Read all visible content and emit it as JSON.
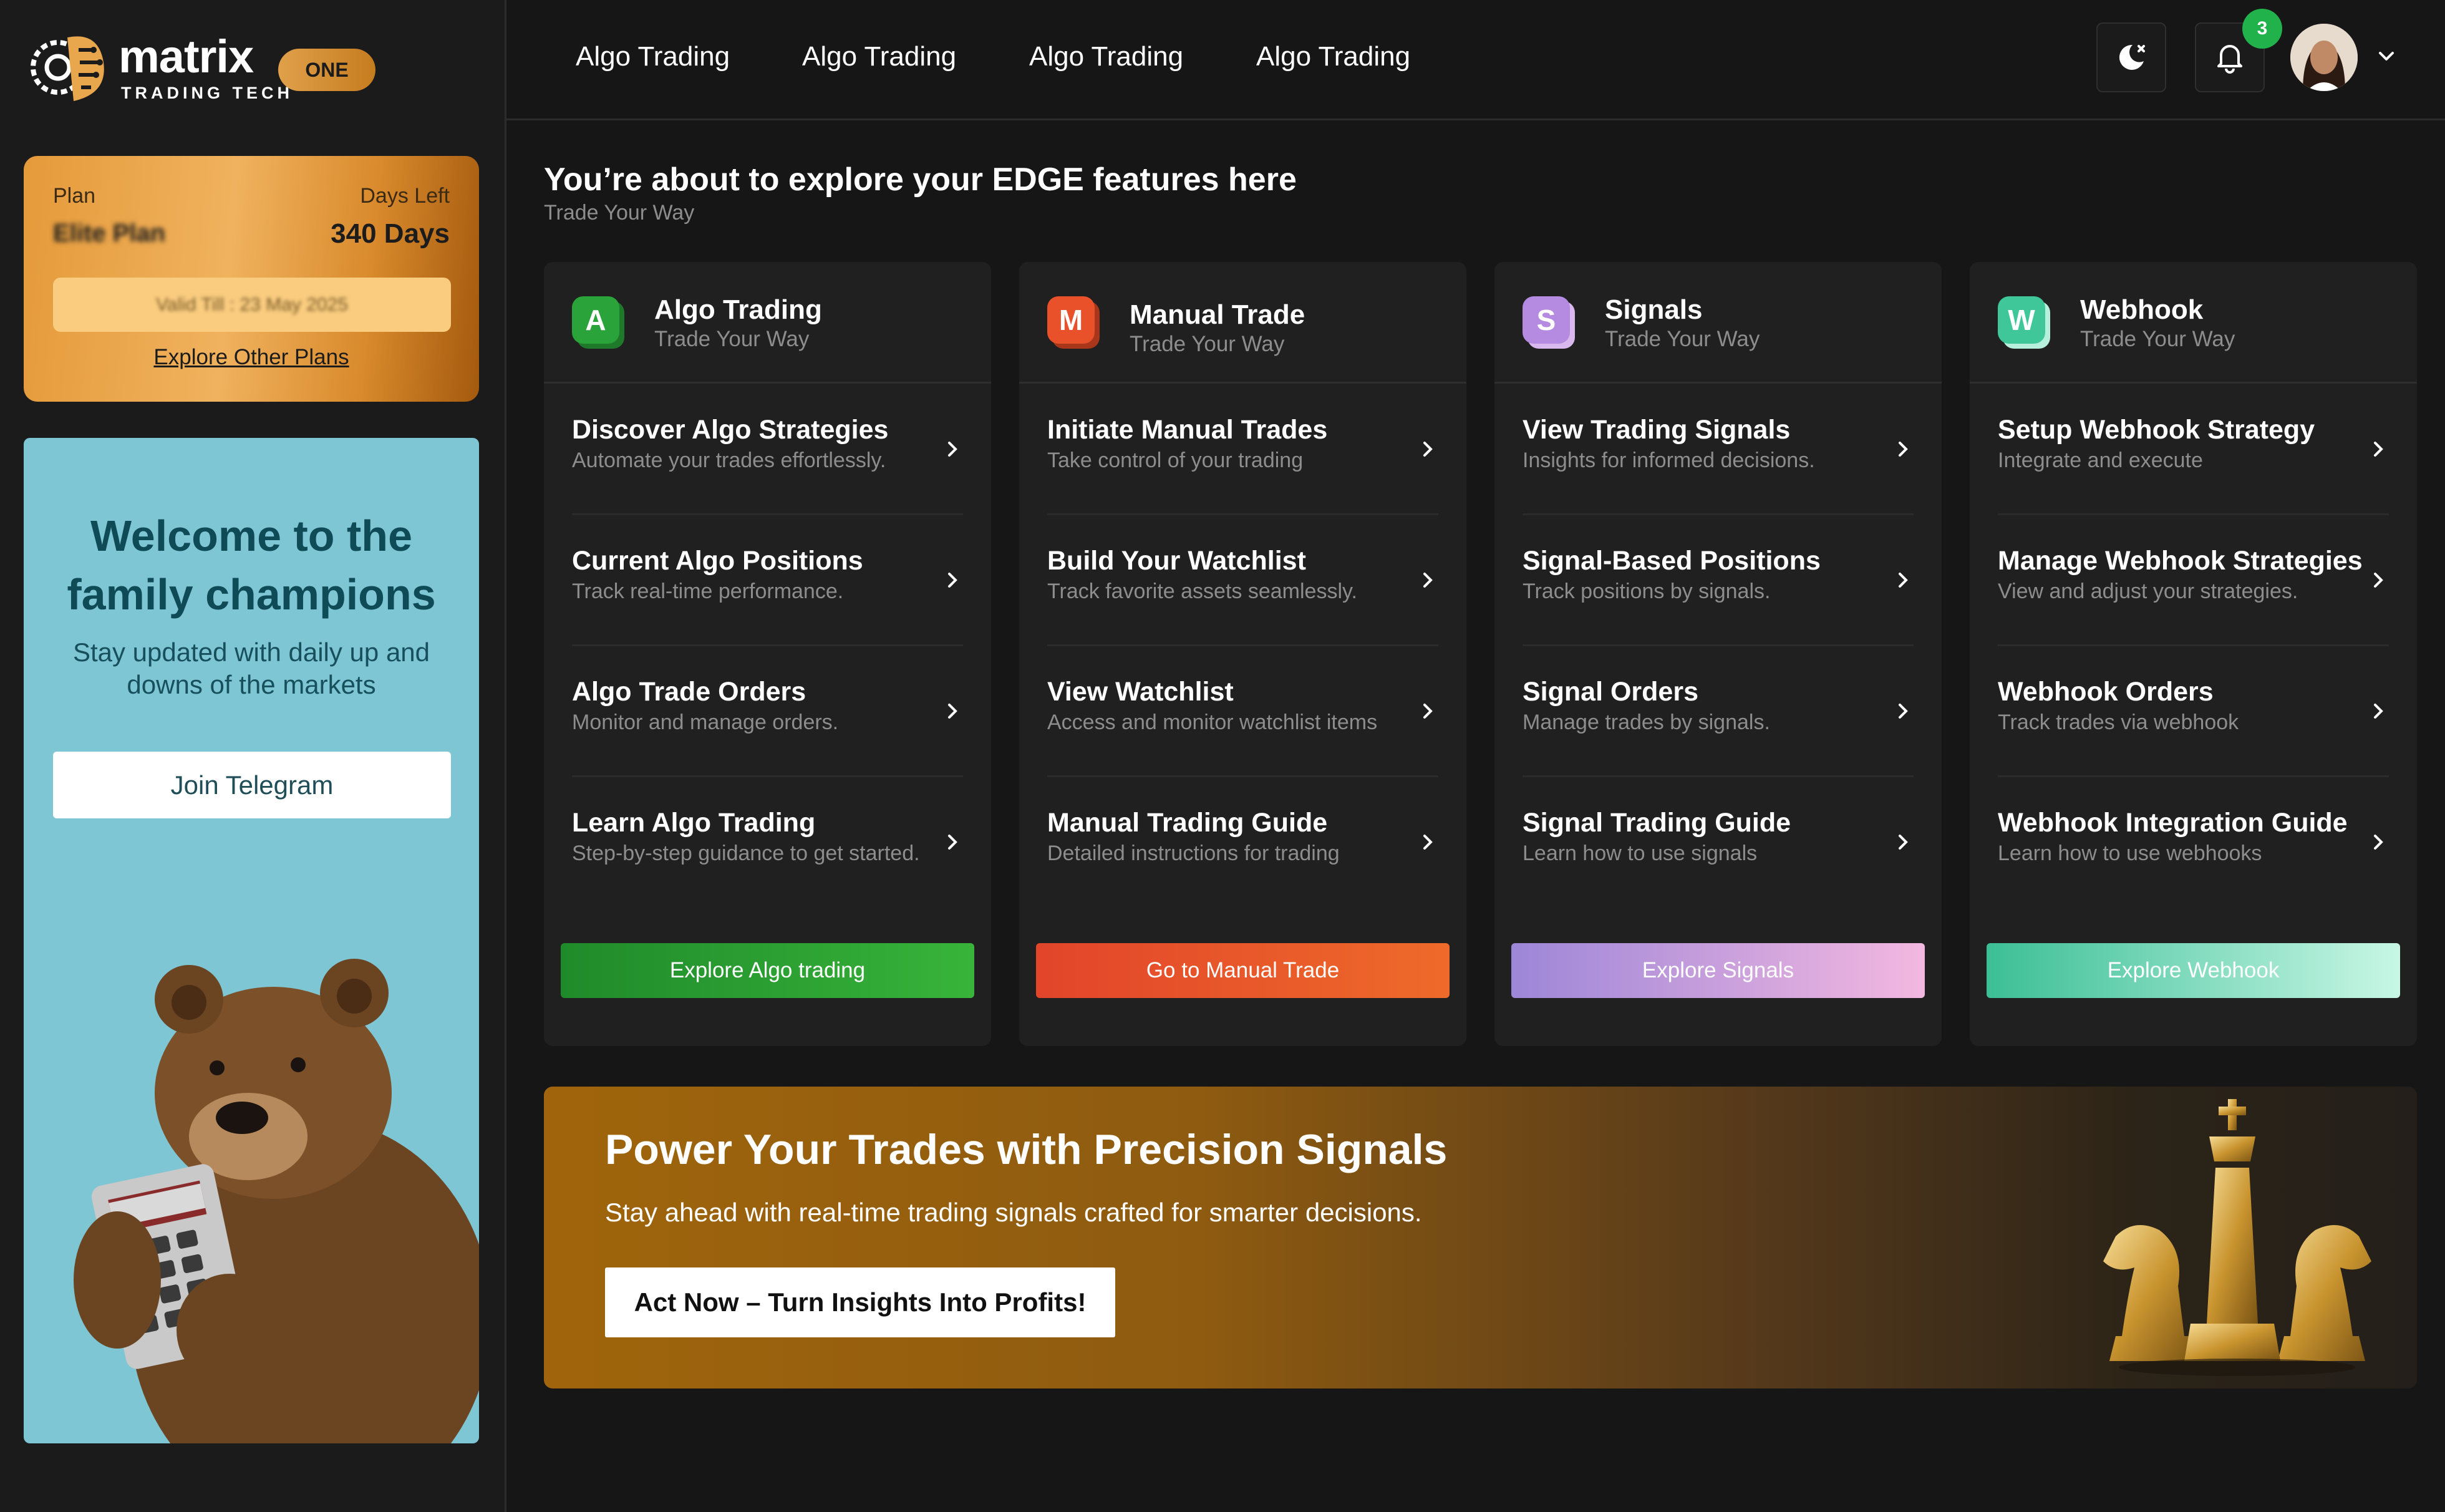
{
  "brand": {
    "name": "matrix",
    "subtitle": "TRADING TECH",
    "badge": "ONE"
  },
  "plan": {
    "plan_label": "Plan",
    "plan_value": "Elite Plan",
    "days_label": "Days Left",
    "days_value": "340 Days",
    "valid_till": "Valid Till : 23 May 2025",
    "explore_link": "Explore Other Plans"
  },
  "promo": {
    "title_line1": "Welcome to the",
    "title_line2": "family champions",
    "subtitle": "Stay updated with daily up and downs of the markets",
    "button": "Join Telegram"
  },
  "nav": {
    "items": [
      "Algo Trading",
      "Algo Trading",
      "Algo Trading",
      "Algo Trading"
    ]
  },
  "header": {
    "notification_count": "3"
  },
  "page": {
    "title": "You’re about to explore your EDGE features here",
    "subtitle": "Trade Your Way"
  },
  "cards": [
    {
      "letter": "A",
      "title": "Algo Trading",
      "tagline": "Trade Your Way",
      "color": "#2aa43a",
      "rows": [
        {
          "title": "Discover Algo Strategies",
          "subtitle": "Automate your trades effortlessly."
        },
        {
          "title": "Current Algo Positions",
          "subtitle": "Track real-time performance."
        },
        {
          "title": "Algo Trade Orders",
          "subtitle": "Monitor and manage orders."
        },
        {
          "title": "Learn Algo Trading",
          "subtitle": "Step-by-step guidance to get started."
        }
      ],
      "button": "Explore Algo trading"
    },
    {
      "letter": "M",
      "title": "Manual Trade",
      "tagline": "Trade Your Way",
      "color": "#e8512a",
      "rows": [
        {
          "title": "Initiate Manual Trades",
          "subtitle": "Take control of your trading"
        },
        {
          "title": "Build Your Watchlist",
          "subtitle": "Track favorite assets seamlessly."
        },
        {
          "title": "View Watchlist",
          "subtitle": "Access and monitor watchlist items"
        },
        {
          "title": "Manual Trading Guide",
          "subtitle": "Detailed instructions for trading"
        }
      ],
      "button": "Go to Manual Trade"
    },
    {
      "letter": "S",
      "title": "Signals",
      "tagline": "Trade Your Way",
      "color": "#b48be0",
      "rows": [
        {
          "title": "View Trading Signals",
          "subtitle": "Insights for informed decisions."
        },
        {
          "title": "Signal-Based Positions",
          "subtitle": "Track positions by signals."
        },
        {
          "title": "Signal Orders",
          "subtitle": "Manage trades by signals."
        },
        {
          "title": "Signal Trading Guide",
          "subtitle": "Learn how to use signals"
        }
      ],
      "button": "Explore Signals"
    },
    {
      "letter": "W",
      "title": "Webhook",
      "tagline": "Trade Your Way",
      "color": "#3fc79a",
      "rows": [
        {
          "title": "Setup Webhook Strategy",
          "subtitle": "Integrate and execute"
        },
        {
          "title": "Manage Webhook Strategies",
          "subtitle": "View and adjust your strategies."
        },
        {
          "title": "Webhook Orders",
          "subtitle": "Track trades via webhook"
        },
        {
          "title": "Webhook Integration Guide",
          "subtitle": "Learn how to use webhooks"
        }
      ],
      "button": "Explore Webhook"
    }
  ],
  "banner": {
    "title": "Power Your Trades with Precision Signals",
    "subtitle": "Stay ahead with real-time trading signals crafted for smarter decisions.",
    "button": "Act Now – Turn Insights Into Profits!"
  },
  "icons": {
    "logo": "gear-brain-logo-icon",
    "theme": "moon-icon",
    "notifications": "bell-icon",
    "chevron": "chevron-right-icon",
    "user_menu": "chevron-down-icon"
  },
  "colors": {
    "background": "#161616",
    "card": "#202020",
    "accent_gold": "#e59a3a",
    "promo_bg": "#7ec6d4",
    "notification_badge": "#22b24c"
  }
}
